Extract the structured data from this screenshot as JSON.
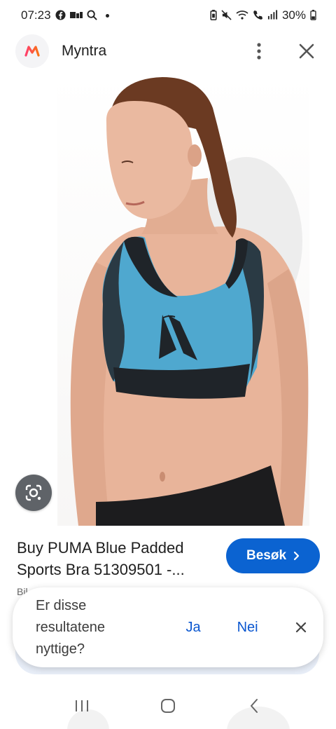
{
  "status_bar": {
    "time": "07:23",
    "battery": "30%",
    "icons_left": [
      "facebook-icon",
      "sim-icon",
      "search-icon"
    ],
    "icons_right": [
      "battery-saver-icon",
      "mute-icon",
      "wifi-icon",
      "call-icon",
      "signal-icon",
      "battery-icon"
    ]
  },
  "app_header": {
    "title": "Myntra",
    "logo": "myntra-logo",
    "actions": [
      "more-vert-icon",
      "close-icon"
    ]
  },
  "result": {
    "title_line1": "Buy PUMA Blue Padded",
    "title_line2": "Sports Bra 51309501 -...",
    "source": "Bil…",
    "visit_label": "Besøk"
  },
  "feedback": {
    "question_line1": "Er disse",
    "question_line2": "resultatene",
    "question_line3": "nyttige?",
    "yes_label": "Ja",
    "no_label": "Nei"
  },
  "colors": {
    "accent": "#0b63d1",
    "link": "#0b57d0",
    "lens_button": "#5f6368",
    "product": "#4fa8cf"
  }
}
